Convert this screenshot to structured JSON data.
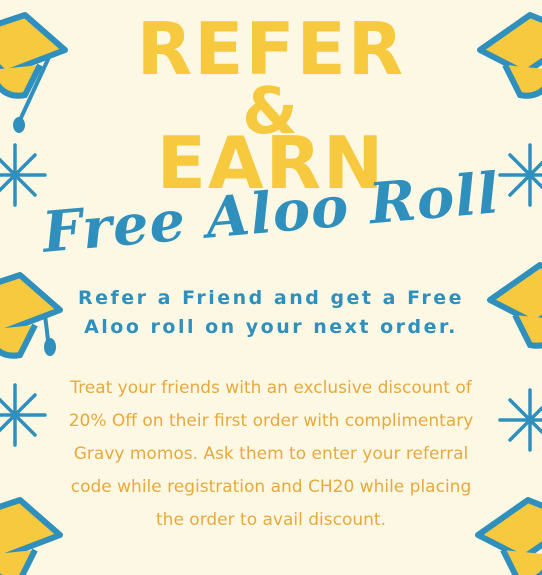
{
  "title": {
    "line1": "REFER",
    "line2": "&",
    "line3": "EARN"
  },
  "subtitle": "Free Aloo Roll",
  "headline": "Refer a Friend and get a Free Aloo roll on your next order.",
  "body": "Treat your friends with an exclusive discount of 20% Off on their first order with complimentary Gravy momos. Ask them to enter your referral code while registration and CH20 while placing the order to avail discount.",
  "colors": {
    "background": "#fdf8e4",
    "yellow": "#f7c93e",
    "blue": "#2f8fbd",
    "orange": "#e8a93c"
  },
  "icons": [
    "graduation-cap-icon",
    "sparkle-icon"
  ]
}
